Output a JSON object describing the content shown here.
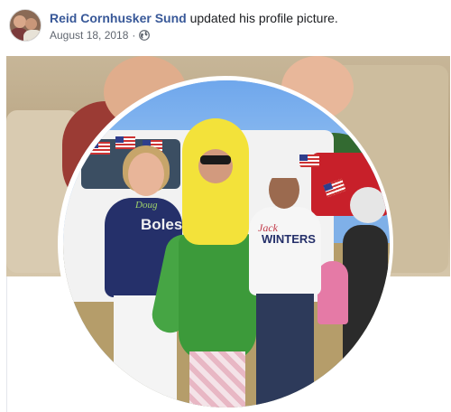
{
  "post": {
    "author": "Reid Cornhusker Sund",
    "action": "updated his profile picture.",
    "date": "August 18, 2018",
    "separator": "·",
    "privacy_icon": "globe-icon"
  },
  "photo": {
    "shirt_left_script": "Doug",
    "shirt_left_name": "Boles",
    "shirt_right_script": "Jack",
    "shirt_right_name": "WINTERS"
  },
  "colors": {
    "author_link": "#385898",
    "meta_text": "#616770",
    "body_text": "#1c1e21"
  }
}
